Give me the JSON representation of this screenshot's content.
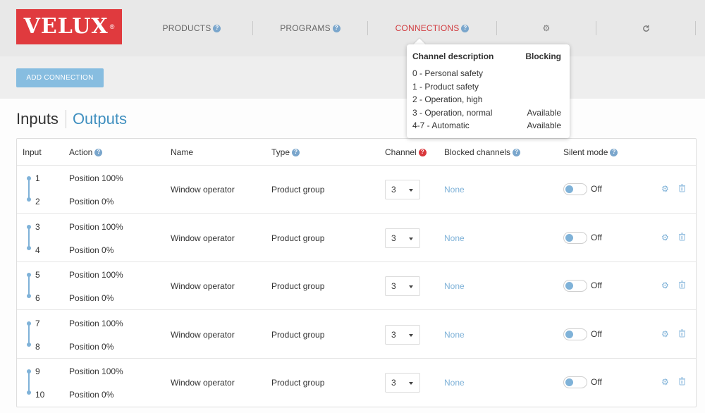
{
  "logo": {
    "text": "VELUX",
    "reg": "®"
  },
  "nav": {
    "products": "PRODUCTS",
    "programs": "PROGRAMS",
    "connections": "CONNECTIONS",
    "settings_icon": "gear-icon",
    "refresh_icon": "refresh-icon"
  },
  "toolbar": {
    "add_connection": "ADD CONNECTION"
  },
  "tabs": {
    "inputs": "Inputs",
    "outputs": "Outputs"
  },
  "table": {
    "headers": {
      "input": "Input",
      "action": "Action",
      "name": "Name",
      "type": "Type",
      "channel": "Channel",
      "blocked": "Blocked channels",
      "silent": "Silent mode"
    },
    "rows": [
      {
        "in1": "1",
        "in2": "2",
        "act1": "Position 100%",
        "act2": "Position 0%",
        "name": "Window operator",
        "type": "Product group",
        "channel": "3",
        "blocked": "None",
        "silent": "Off"
      },
      {
        "in1": "3",
        "in2": "4",
        "act1": "Position 100%",
        "act2": "Position 0%",
        "name": "Window operator",
        "type": "Product group",
        "channel": "3",
        "blocked": "None",
        "silent": "Off"
      },
      {
        "in1": "5",
        "in2": "6",
        "act1": "Position 100%",
        "act2": "Position 0%",
        "name": "Window operator",
        "type": "Product group",
        "channel": "3",
        "blocked": "None",
        "silent": "Off"
      },
      {
        "in1": "7",
        "in2": "8",
        "act1": "Position 100%",
        "act2": "Position 0%",
        "name": "Window operator",
        "type": "Product group",
        "channel": "3",
        "blocked": "None",
        "silent": "Off"
      },
      {
        "in1": "9",
        "in2": "10",
        "act1": "Position 100%",
        "act2": "Position 0%",
        "name": "Window operator",
        "type": "Product group",
        "channel": "3",
        "blocked": "None",
        "silent": "Off"
      }
    ]
  },
  "tooltip": {
    "col1": "Channel description",
    "col2": "Blocking",
    "items": [
      {
        "label": "0 - Personal safety",
        "blocking": ""
      },
      {
        "label": "1 - Product safety",
        "blocking": ""
      },
      {
        "label": "2 - Operation, high",
        "blocking": ""
      },
      {
        "label": "3 - Operation, normal",
        "blocking": "Available"
      },
      {
        "label": "4-7 - Automatic",
        "blocking": "Available"
      }
    ]
  },
  "colors": {
    "brand": "#e03a3e",
    "accent": "#7fb2d8",
    "active_nav": "#d13b3f",
    "button": "#87bde0"
  }
}
